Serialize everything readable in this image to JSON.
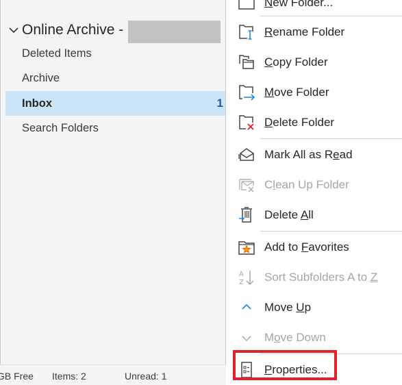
{
  "folder_pane": {
    "account": {
      "name": "Online Archive -",
      "expanded": true,
      "redacted": true
    },
    "folders": [
      {
        "label": "Deleted Items",
        "selected": false,
        "unread": null
      },
      {
        "label": "Archive",
        "selected": false,
        "unread": null
      },
      {
        "label": "Inbox",
        "selected": true,
        "unread": "1"
      },
      {
        "label": "Search Folders",
        "selected": false,
        "unread": null
      }
    ]
  },
  "status_bar": {
    "free_space": "GB Free",
    "items": "Items: 2",
    "unread": "Unread: 1"
  },
  "context_menu": {
    "items": [
      {
        "id": "new-folder",
        "label": "New Folder...",
        "accel": "N",
        "enabled": true,
        "icon": "new-folder-icon"
      },
      {
        "id": "rename-folder",
        "label": "Rename Folder",
        "accel": "R",
        "enabled": true,
        "icon": "rename-folder-icon"
      },
      {
        "id": "copy-folder",
        "label": "Copy Folder",
        "accel": "C",
        "enabled": true,
        "icon": "copy-folder-icon"
      },
      {
        "id": "move-folder",
        "label": "Move Folder",
        "accel": "M",
        "enabled": true,
        "icon": "move-folder-icon"
      },
      {
        "id": "delete-folder",
        "label": "Delete Folder",
        "accel": "D",
        "enabled": true,
        "icon": "delete-folder-icon"
      },
      {
        "id": "mark-all-read",
        "label": "Mark All as Read",
        "accel": "e",
        "enabled": true,
        "icon": "open-envelope-icon"
      },
      {
        "id": "clean-up-folder",
        "label": "Clean Up Folder",
        "accel": "l",
        "enabled": false,
        "icon": "clean-up-icon"
      },
      {
        "id": "delete-all",
        "label": "Delete All",
        "accel": "A",
        "enabled": true,
        "icon": "trash-icon"
      },
      {
        "id": "add-to-favorites",
        "label": "Add to Favorites",
        "accel": "F",
        "enabled": true,
        "icon": "favorite-folder-icon"
      },
      {
        "id": "sort-subfolders",
        "label": "Sort Subfolders A to Z",
        "accel": "Z",
        "enabled": false,
        "icon": "sort-az-icon"
      },
      {
        "id": "move-up",
        "label": "Move Up",
        "accel": "U",
        "enabled": true,
        "icon": "chevron-up-icon"
      },
      {
        "id": "move-down",
        "label": "Move Down",
        "accel": "o",
        "enabled": false,
        "icon": "chevron-down-icon"
      },
      {
        "id": "properties",
        "label": "Properties...",
        "accel": "P",
        "enabled": true,
        "icon": "properties-icon",
        "highlighted": true
      }
    ]
  },
  "colors": {
    "selection": "#cce4f7",
    "unread_count": "#2b5797",
    "accent_icon": "#1e88e5",
    "delete_x": "#e81123",
    "star": "#f7630c",
    "highlight_box": "#e3202b",
    "disabled_text": "#a6a6a6"
  }
}
